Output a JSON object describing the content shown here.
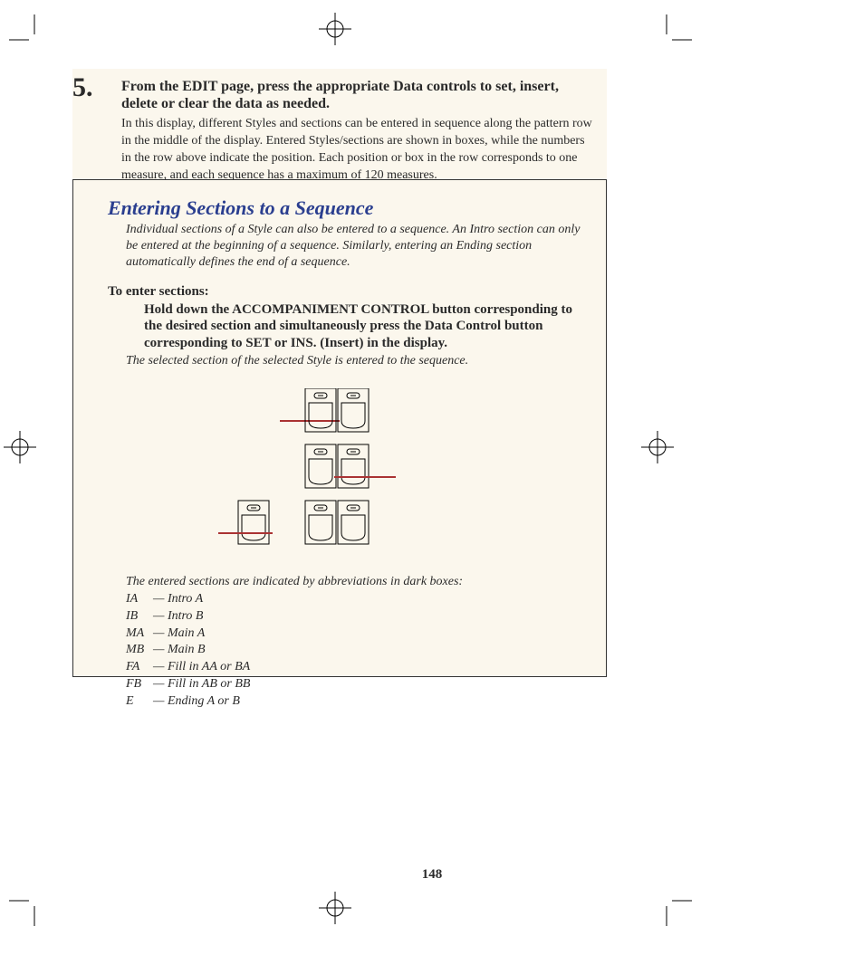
{
  "step": {
    "number": "5.",
    "title": "From the EDIT page, press the appropriate Data controls to set, insert, delete or clear the data as needed.",
    "desc": "In this display, different Styles and sections can be entered in sequence along the pattern row in the middle of the display.  Entered Styles/sections are shown in boxes, while the numbers in the row above indicate the position.  Each position or box in the row corresponds to one measure, and each sequence has a maximum of 120 measures."
  },
  "section": {
    "title": "Entering Sections to a Sequence",
    "intro": "Individual sections of a Style can also be entered to a sequence.  An Intro section can only be entered at the beginning of a sequence.  Similarly, entering an Ending section automatically defines the end of a sequence.",
    "subhead": "To enter sections:",
    "instruction": "Hold down the ACCOMPANIMENT CONTROL button corresponding to the desired section and simultaneously press the Data Control button corresponding to SET or INS. (Insert) in the display.",
    "instruction_note": "The selected section of the selected Style is entered to the sequence.",
    "indicated_note": "The entered sections are indicated by abbreviations in dark boxes:",
    "abbrs": [
      {
        "code": "IA",
        "label": "— Intro A"
      },
      {
        "code": "IB",
        "label": "— Intro B"
      },
      {
        "code": "MA",
        "label": "— Main A"
      },
      {
        "code": "MB",
        "label": "— Main B"
      },
      {
        "code": "FA",
        "label": "— Fill in AA or BA"
      },
      {
        "code": "FB",
        "label": "— Fill in AB or BB"
      },
      {
        "code": "E",
        "label": "— Ending A or B"
      }
    ]
  },
  "page_number": "148"
}
